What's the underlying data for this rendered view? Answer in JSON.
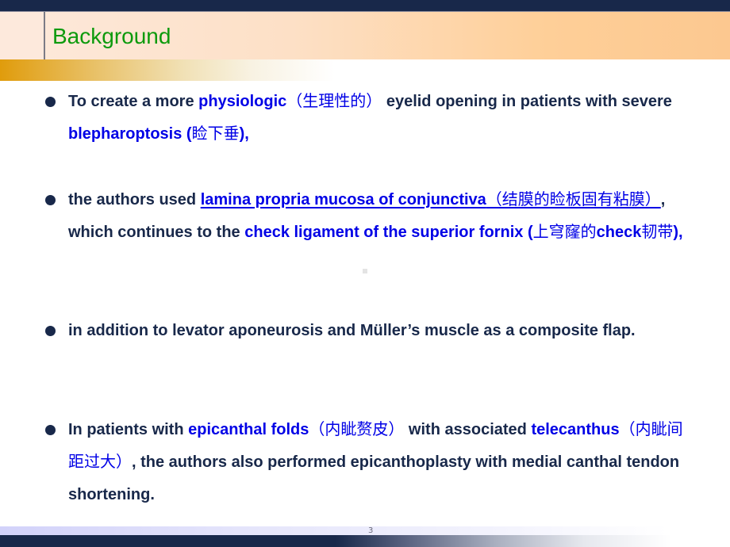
{
  "slide": {
    "title": "Background",
    "page_number": "3"
  },
  "bullets": [
    {
      "segments": [
        {
          "text": "To create a more ",
          "style": "normal"
        },
        {
          "text": "physiologic",
          "style": "highlight"
        },
        {
          "text": "（生理性的）",
          "style": "highlight-cjk"
        },
        {
          "text": " eyelid opening in patients with severe ",
          "style": "normal"
        },
        {
          "text": "blepharoptosis (",
          "style": "highlight"
        },
        {
          "text": "睑下垂",
          "style": "highlight-cjk"
        },
        {
          "text": "),",
          "style": "highlight"
        }
      ]
    },
    {
      "segments": [
        {
          "text": "the authors used ",
          "style": "normal"
        },
        {
          "text": "lamina propria mucosa of conjunctiva",
          "style": "highlight-underline"
        },
        {
          "text": "（结膜的睑板固有粘膜）",
          "style": "highlight-underline-cjk"
        },
        {
          "text": ", which continues to the ",
          "style": "normal"
        },
        {
          "text": "check ligament of the superior fornix (",
          "style": "highlight"
        },
        {
          "text": "上穹窿的",
          "style": "highlight-cjk"
        },
        {
          "text": "check",
          "style": "highlight"
        },
        {
          "text": "韧带",
          "style": "highlight-cjk"
        },
        {
          "text": "),",
          "style": "highlight"
        }
      ]
    },
    {
      "segments": [
        {
          "text": "in addition to levator aponeurosis and Müller’s muscle as a composite flap.",
          "style": "normal"
        }
      ]
    },
    {
      "segments": [
        {
          "text": "In patients with ",
          "style": "normal"
        },
        {
          "text": "epicanthal folds",
          "style": "highlight"
        },
        {
          "text": "（内眦赘皮）",
          "style": "highlight-cjk"
        },
        {
          "text": " with associated ",
          "style": "normal"
        },
        {
          "text": "telecanthus",
          "style": "highlight"
        },
        {
          "text": "（内眦间距过大）",
          "style": "highlight-cjk"
        },
        {
          "text": ", the authors also performed epicanthoplasty with medial canthal tendon shortening.",
          "style": "normal"
        }
      ]
    }
  ],
  "colors": {
    "title": "#0d9a0d",
    "body_text": "#18284a",
    "highlight": "#0000e6",
    "navy_bar": "#18284a"
  }
}
